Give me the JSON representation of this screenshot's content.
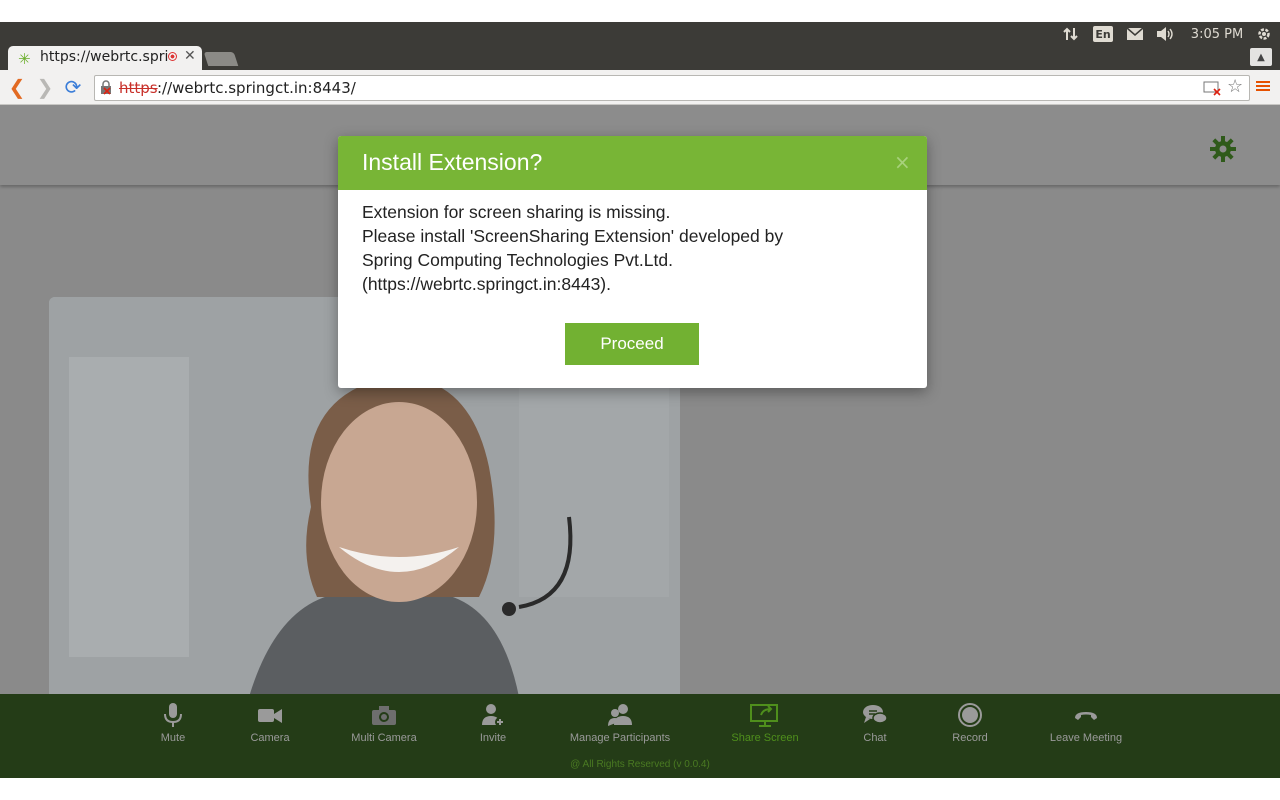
{
  "system": {
    "language": "En",
    "clock": "3:05 PM",
    "icons": [
      "network-arrows-icon",
      "keyboard-language-icon",
      "mail-icon",
      "volume-icon",
      "power-gear-icon"
    ]
  },
  "browser": {
    "tab_title": "https://webrtc.springct.in:8443/",
    "tab_title_visible": "https://webrtc.sp",
    "url_scheme": "https",
    "url_rest": "://webrtc.springct.in:8443/"
  },
  "modal": {
    "title": "Install Extension?",
    "close": "×",
    "body_lines": [
      "Extension for screen sharing is missing.",
      "Please install 'ScreenSharing Extension' developed by",
      "Spring Computing Technologies Pvt.Ltd.",
      "(https://webrtc.springct.in:8443)."
    ],
    "proceed_label": "Proceed"
  },
  "controls": [
    {
      "label": "Mute",
      "icon": "microphone-icon"
    },
    {
      "label": "Camera",
      "icon": "video-camera-icon"
    },
    {
      "label": "Multi Camera",
      "icon": "photo-camera-icon"
    },
    {
      "label": "Invite",
      "icon": "add-user-icon"
    },
    {
      "label": "Manage Participants",
      "icon": "participants-icon"
    },
    {
      "label": "Share Screen",
      "icon": "share-screen-icon"
    },
    {
      "label": "Chat",
      "icon": "chat-icon"
    },
    {
      "label": "Record",
      "icon": "record-icon"
    },
    {
      "label": "Leave Meeting",
      "icon": "hang-up-icon"
    }
  ],
  "footer": "@ All Rights Reserved (v 0.0.4)",
  "colors": {
    "accent": "#78b536",
    "bottombar": "#243c17",
    "active_control": "#4f8f1c"
  }
}
